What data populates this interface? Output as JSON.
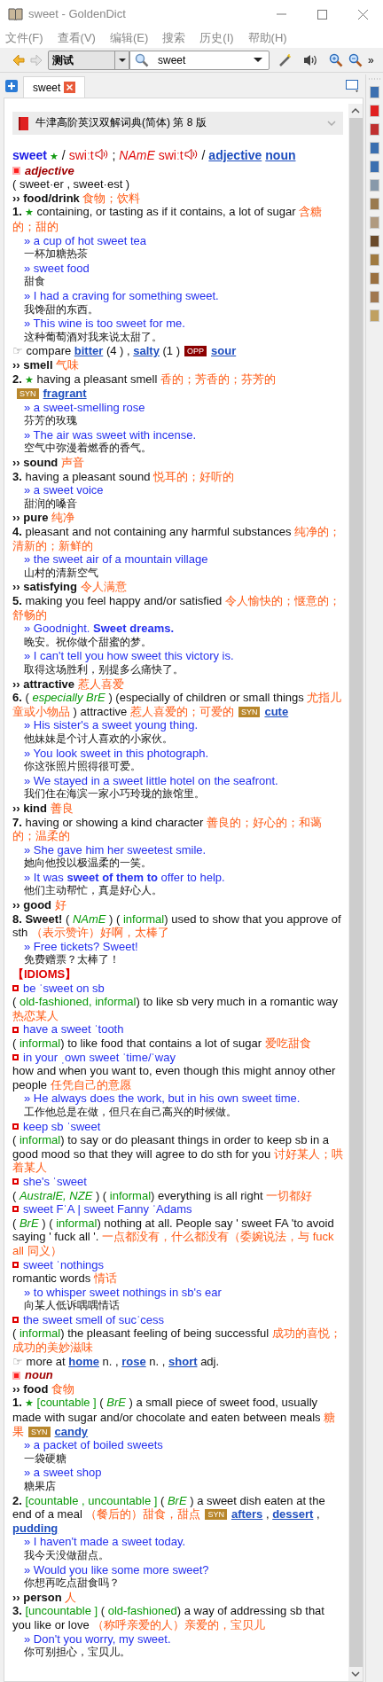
{
  "window": {
    "title": "sweet - GoldenDict"
  },
  "menu": [
    "文件(F)",
    "查看(V)",
    "编辑(E)",
    "搜索",
    "历史(I)",
    "帮助(H)"
  ],
  "toolbar": {
    "group": "测试",
    "search": "sweet",
    "more": "»"
  },
  "tabs": [
    {
      "label": "sweet",
      "selected": true
    }
  ],
  "dictionary": {
    "title": "牛津高阶英汉双解词典(简体) 第 8 版"
  },
  "entry": [
    {
      "kind": "headword",
      "parts": [
        {
          "kind": "headword",
          "text": "sweet"
        },
        {
          "kind": "star",
          "text": " ★"
        },
        {
          "kind": "plain",
          "text": " / "
        },
        {
          "kind": "pron",
          "text": "swiːt"
        },
        {
          "kind": "speaker"
        },
        {
          "kind": "plain",
          "text": " ; "
        },
        {
          "kind": "pron_i",
          "text": "NAmE"
        },
        {
          "kind": "pron",
          "text": " swiːt"
        },
        {
          "kind": "speaker"
        },
        {
          "kind": "plain",
          "text": " / "
        },
        {
          "kind": "link",
          "text": "adjective"
        },
        {
          "kind": "link",
          "text": "noun"
        }
      ]
    },
    {
      "kind": "pos",
      "parts": [
        {
          "kind": "pos",
          "text": "adjective"
        }
      ]
    },
    {
      "kind": "line",
      "parts": [
        {
          "kind": "plain",
          "text": "( sweet·er , sweet·est )"
        }
      ]
    },
    {
      "kind": "section",
      "parts": [
        {
          "kind": "bold",
          "text": "›› food/drink"
        },
        {
          "kind": "zh",
          "text": " 食物；饮料"
        }
      ]
    },
    {
      "kind": "line",
      "parts": [
        {
          "kind": "bold",
          "text": "1."
        },
        {
          "kind": "star",
          "text": " ★"
        },
        {
          "kind": "plain",
          "text": "  containing, or tasting as if it contains, a lot of sugar "
        },
        {
          "kind": "zh",
          "text": "含糖的；甜的"
        }
      ]
    },
    {
      "kind": "example",
      "parts": [
        {
          "kind": "example",
          "text": "» a cup of hot sweet tea"
        }
      ]
    },
    {
      "kind": "translation",
      "parts": [
        {
          "kind": "plain",
          "text": "一杯加糖热茶"
        }
      ]
    },
    {
      "kind": "example",
      "parts": [
        {
          "kind": "example",
          "text": "» sweet food"
        }
      ]
    },
    {
      "kind": "translation",
      "parts": [
        {
          "kind": "plain",
          "text": "甜食"
        }
      ]
    },
    {
      "kind": "example",
      "parts": [
        {
          "kind": "example",
          "text": "» I had a craving for something sweet."
        }
      ]
    },
    {
      "kind": "translation",
      "parts": [
        {
          "kind": "plain",
          "text": "我馋甜的东西。"
        }
      ]
    },
    {
      "kind": "example",
      "parts": [
        {
          "kind": "example",
          "text": "» This wine is too sweet for me."
        }
      ]
    },
    {
      "kind": "translation",
      "parts": [
        {
          "kind": "plain",
          "text": "这种葡萄酒对我来说太甜了。"
        }
      ]
    },
    {
      "kind": "line",
      "parts": [
        {
          "kind": "hand",
          "text": "☞"
        },
        {
          "kind": "plain",
          "text": " compare "
        },
        {
          "kind": "link",
          "text": "bitter"
        },
        {
          "kind": "plain",
          "text": "  (4 ) , "
        },
        {
          "kind": "link",
          "text": "salty"
        },
        {
          "kind": "plain",
          "text": "  (1 )"
        },
        {
          "kind": "opp",
          "text": "OPP"
        },
        {
          "kind": "link",
          "text": "sour"
        }
      ]
    },
    {
      "kind": "section",
      "parts": [
        {
          "kind": "bold",
          "text": "›› smell"
        },
        {
          "kind": "zh",
          "text": " 气味"
        }
      ]
    },
    {
      "kind": "line",
      "parts": [
        {
          "kind": "bold",
          "text": "2."
        },
        {
          "kind": "star",
          "text": " ★"
        },
        {
          "kind": "plain",
          "text": "  having a pleasant smell "
        },
        {
          "kind": "zh",
          "text": "香的；芳香的；芬芳的"
        },
        {
          "kind": "syn",
          "text": "SYN"
        },
        {
          "kind": "link",
          "text": "fragrant"
        }
      ]
    },
    {
      "kind": "example",
      "parts": [
        {
          "kind": "example",
          "text": "» a sweet-smelling rose"
        }
      ]
    },
    {
      "kind": "translation",
      "parts": [
        {
          "kind": "plain",
          "text": "芬芳的玫瑰"
        }
      ]
    },
    {
      "kind": "example",
      "parts": [
        {
          "kind": "example",
          "text": "» The air was sweet with incense."
        }
      ]
    },
    {
      "kind": "translation",
      "parts": [
        {
          "kind": "plain",
          "text": "空气中弥漫着燃香的香气。"
        }
      ]
    },
    {
      "kind": "section",
      "parts": [
        {
          "kind": "bold",
          "text": "›› sound"
        },
        {
          "kind": "zh",
          "text": " 声音"
        }
      ]
    },
    {
      "kind": "line",
      "parts": [
        {
          "kind": "bold",
          "text": "3."
        },
        {
          "kind": "plain",
          "text": "  having a pleasant sound "
        },
        {
          "kind": "zh",
          "text": "悦耳的；好听的"
        }
      ]
    },
    {
      "kind": "example",
      "parts": [
        {
          "kind": "example",
          "text": "» a sweet voice"
        }
      ]
    },
    {
      "kind": "translation",
      "parts": [
        {
          "kind": "plain",
          "text": "甜润的嗓音"
        }
      ]
    },
    {
      "kind": "section",
      "parts": [
        {
          "kind": "bold",
          "text": "›› pure"
        },
        {
          "kind": "zh",
          "text": " 纯净"
        }
      ]
    },
    {
      "kind": "line",
      "parts": [
        {
          "kind": "bold",
          "text": "4."
        },
        {
          "kind": "plain",
          "text": "  pleasant and not containing any harmful substances "
        },
        {
          "kind": "zh",
          "text": "纯净的；清新的；新鲜的"
        }
      ]
    },
    {
      "kind": "example",
      "parts": [
        {
          "kind": "example",
          "text": "» the sweet air of a mountain village"
        }
      ]
    },
    {
      "kind": "translation",
      "parts": [
        {
          "kind": "plain",
          "text": "山村的清新空气"
        }
      ]
    },
    {
      "kind": "section",
      "parts": [
        {
          "kind": "bold",
          "text": "›› satisfying"
        },
        {
          "kind": "zh",
          "text": " 令人满意"
        }
      ]
    },
    {
      "kind": "line",
      "parts": [
        {
          "kind": "bold",
          "text": "5."
        },
        {
          "kind": "plain",
          "text": "  making you feel happy and/or satisfied "
        },
        {
          "kind": "zh",
          "text": "令人愉快的；惬意的；舒畅的"
        }
      ]
    },
    {
      "kind": "example",
      "parts": [
        {
          "kind": "example",
          "text": "» Goodnight. "
        },
        {
          "kind": "example_bold",
          "text": "Sweet dreams."
        }
      ]
    },
    {
      "kind": "translation",
      "parts": [
        {
          "kind": "plain",
          "text": "晚安。祝你做个甜蜜的梦。"
        }
      ]
    },
    {
      "kind": "example",
      "parts": [
        {
          "kind": "example",
          "text": "» I can't tell you how sweet this victory is."
        }
      ]
    },
    {
      "kind": "translation",
      "parts": [
        {
          "kind": "plain",
          "text": "取得这场胜利，别提多么痛快了。"
        }
      ]
    },
    {
      "kind": "section",
      "parts": [
        {
          "kind": "bold",
          "text": "›› attractive"
        },
        {
          "kind": "zh",
          "text": " 惹人喜爱"
        }
      ]
    },
    {
      "kind": "line",
      "parts": [
        {
          "kind": "bold",
          "text": "6."
        },
        {
          "kind": "plain",
          "text": " ( "
        },
        {
          "kind": "label_i",
          "text": "especially BrE"
        },
        {
          "kind": "plain",
          "text": " ) (especially of children or small things "
        },
        {
          "kind": "zh",
          "text": "尤指儿童或小物品"
        },
        {
          "kind": "plain",
          "text": " ) attractive "
        },
        {
          "kind": "zh",
          "text": "惹人喜爱的；可爱的"
        },
        {
          "kind": "syn",
          "text": "SYN"
        },
        {
          "kind": "link",
          "text": "cute"
        }
      ]
    },
    {
      "kind": "example",
      "parts": [
        {
          "kind": "example",
          "text": "» His sister's a sweet young thing."
        }
      ]
    },
    {
      "kind": "translation",
      "parts": [
        {
          "kind": "plain",
          "text": "他妹妹是个讨人喜欢的小家伙。"
        }
      ]
    },
    {
      "kind": "example",
      "parts": [
        {
          "kind": "example",
          "text": "» You look sweet in this photograph."
        }
      ]
    },
    {
      "kind": "translation",
      "parts": [
        {
          "kind": "plain",
          "text": "你这张照片照得很可爱。"
        }
      ]
    },
    {
      "kind": "example",
      "parts": [
        {
          "kind": "example",
          "text": "» We stayed in a sweet little hotel on the seafront."
        }
      ]
    },
    {
      "kind": "translation",
      "parts": [
        {
          "kind": "plain",
          "text": "我们住在海滨一家小巧玲珑的旅馆里。"
        }
      ]
    },
    {
      "kind": "section",
      "parts": [
        {
          "kind": "bold",
          "text": "›› kind"
        },
        {
          "kind": "zh",
          "text": " 善良"
        }
      ]
    },
    {
      "kind": "line",
      "parts": [
        {
          "kind": "bold",
          "text": "7."
        },
        {
          "kind": "plain",
          "text": "  having or showing a kind character "
        },
        {
          "kind": "zh",
          "text": "善良的；好心的；和蔼的；温柔的"
        }
      ]
    },
    {
      "kind": "example",
      "parts": [
        {
          "kind": "example",
          "text": "» She gave him her sweetest smile."
        }
      ]
    },
    {
      "kind": "translation",
      "parts": [
        {
          "kind": "plain",
          "text": "她向他投以极温柔的一笑。"
        }
      ]
    },
    {
      "kind": "example",
      "parts": [
        {
          "kind": "example",
          "text": "» It was "
        },
        {
          "kind": "example_bold",
          "text": "sweet of them to"
        },
        {
          "kind": "example",
          "text": " offer to help."
        }
      ]
    },
    {
      "kind": "translation",
      "parts": [
        {
          "kind": "plain",
          "text": "他们主动帮忙，真是好心人。"
        }
      ]
    },
    {
      "kind": "section",
      "parts": [
        {
          "kind": "bold",
          "text": "›› good"
        },
        {
          "kind": "zh",
          "text": " 好"
        }
      ]
    },
    {
      "kind": "line",
      "parts": [
        {
          "kind": "bold",
          "text": "8. Sweet!"
        },
        {
          "kind": "plain",
          "text": " ( "
        },
        {
          "kind": "label_i",
          "text": "NAmE"
        },
        {
          "kind": "plain",
          "text": " ) ( "
        },
        {
          "kind": "label",
          "text": "informal"
        },
        {
          "kind": "plain",
          "text": ") used to show that you approve of sth "
        },
        {
          "kind": "zh",
          "text": "（表示赞许）好啊，太棒了"
        }
      ]
    },
    {
      "kind": "example",
      "parts": [
        {
          "kind": "example",
          "text": "» Free tickets? Sweet!"
        }
      ]
    },
    {
      "kind": "translation",
      "parts": [
        {
          "kind": "plain",
          "text": "免费赠票？太棒了！"
        }
      ]
    },
    {
      "kind": "idioms_heading",
      "parts": [
        {
          "kind": "heading",
          "text": "【IDIOMS】"
        }
      ]
    },
    {
      "kind": "idiom",
      "parts": [
        {
          "kind": "example",
          "text": "be ˈsweet on sb"
        }
      ]
    },
    {
      "kind": "line",
      "parts": [
        {
          "kind": "plain",
          "text": "( "
        },
        {
          "kind": "label",
          "text": "old-fashioned, informal"
        },
        {
          "kind": "plain",
          "text": ") to like sb very much in a romantic way "
        },
        {
          "kind": "zh",
          "text": "热恋某人"
        }
      ]
    },
    {
      "kind": "idiom",
      "parts": [
        {
          "kind": "example",
          "text": "have a sweet ˈtooth"
        }
      ]
    },
    {
      "kind": "line",
      "parts": [
        {
          "kind": "plain",
          "text": "( "
        },
        {
          "kind": "label",
          "text": "informal"
        },
        {
          "kind": "plain",
          "text": ") to like food that contains a lot of sugar "
        },
        {
          "kind": "zh",
          "text": "爱吃甜食"
        }
      ]
    },
    {
      "kind": "idiom",
      "parts": [
        {
          "kind": "example",
          "text": "in your ˌown sweet ˈtime/ˈway"
        }
      ]
    },
    {
      "kind": "line",
      "parts": [
        {
          "kind": "plain",
          "text": " how and when you want to, even though this might annoy other people "
        },
        {
          "kind": "zh",
          "text": "任凭自己的意愿"
        }
      ]
    },
    {
      "kind": "example",
      "parts": [
        {
          "kind": "example",
          "text": "» He always does the work, but in his own sweet time."
        }
      ]
    },
    {
      "kind": "translation",
      "parts": [
        {
          "kind": "plain",
          "text": "工作他总是在做，但只在自己高兴的时候做。"
        }
      ]
    },
    {
      "kind": "idiom",
      "parts": [
        {
          "kind": "example",
          "text": "keep sb ˈsweet"
        }
      ]
    },
    {
      "kind": "line",
      "parts": [
        {
          "kind": "plain",
          "text": "( "
        },
        {
          "kind": "label",
          "text": "informal"
        },
        {
          "kind": "plain",
          "text": ") to say or do pleasant things in order to keep sb in a good mood so that they will agree to do sth for you "
        },
        {
          "kind": "zh",
          "text": "讨好某人；哄着某人"
        }
      ]
    },
    {
      "kind": "idiom",
      "parts": [
        {
          "kind": "example",
          "text": "she's ˈsweet"
        }
      ]
    },
    {
      "kind": "line",
      "parts": [
        {
          "kind": "plain",
          "text": "( "
        },
        {
          "kind": "label_i",
          "text": "AustralE,  NZE"
        },
        {
          "kind": "plain",
          "text": " ) ( "
        },
        {
          "kind": "label",
          "text": "informal"
        },
        {
          "kind": "plain",
          "text": ") everything is all right "
        },
        {
          "kind": "zh",
          "text": "一切都好"
        }
      ]
    },
    {
      "kind": "idiom",
      "parts": [
        {
          "kind": "example",
          "text": "sweet FˈA | sweet Fanny ˈAdams"
        }
      ]
    },
    {
      "kind": "line",
      "parts": [
        {
          "kind": "plain",
          "text": "( "
        },
        {
          "kind": "label_i",
          "text": "BrE"
        },
        {
          "kind": "plain",
          "text": " ) ( "
        },
        {
          "kind": "label",
          "text": "informal"
        },
        {
          "kind": "plain",
          "text": ") nothing at all. People say ' sweet FA 'to avoid saying ' fuck all '. "
        },
        {
          "kind": "zh",
          "text": "一点都没有，什么都没有（委婉说法，与 fuck all 同义）"
        }
      ]
    },
    {
      "kind": "idiom",
      "parts": [
        {
          "kind": "example",
          "text": "sweet ˈnothings"
        }
      ]
    },
    {
      "kind": "line",
      "parts": [
        {
          "kind": "plain",
          "text": " romantic words "
        },
        {
          "kind": "zh",
          "text": "情话"
        }
      ]
    },
    {
      "kind": "example",
      "parts": [
        {
          "kind": "example",
          "text": "» to whisper sweet nothings in sb's ear"
        }
      ]
    },
    {
      "kind": "translation",
      "parts": [
        {
          "kind": "plain",
          "text": "向某人低诉喁喁情话"
        }
      ]
    },
    {
      "kind": "idiom",
      "parts": [
        {
          "kind": "example",
          "text": "the sweet smell of sucˈcess"
        }
      ]
    },
    {
      "kind": "line",
      "parts": [
        {
          "kind": "plain",
          "text": "( "
        },
        {
          "kind": "label",
          "text": "informal"
        },
        {
          "kind": "plain",
          "text": ") the pleasant feeling of being successful "
        },
        {
          "kind": "zh",
          "text": "成功的喜悦；成功的美妙滋味"
        }
      ]
    },
    {
      "kind": "line",
      "parts": [
        {
          "kind": "hand",
          "text": "☞"
        },
        {
          "kind": "plain",
          "text": " more at "
        },
        {
          "kind": "link",
          "text": "home"
        },
        {
          "kind": "plain",
          "text": "  n. , "
        },
        {
          "kind": "link",
          "text": "rose"
        },
        {
          "kind": "plain",
          "text": "  n. , "
        },
        {
          "kind": "link",
          "text": "short"
        },
        {
          "kind": "plain",
          "text": "  adj."
        }
      ]
    },
    {
      "kind": "pos",
      "parts": [
        {
          "kind": "pos",
          "text": "noun"
        }
      ]
    },
    {
      "kind": "section",
      "parts": [
        {
          "kind": "bold",
          "text": "›› food"
        },
        {
          "kind": "zh",
          "text": " 食物"
        }
      ]
    },
    {
      "kind": "line",
      "parts": [
        {
          "kind": "bold",
          "text": "1."
        },
        {
          "kind": "star",
          "text": " ★"
        },
        {
          "kind": "label",
          "text": " [countable ]"
        },
        {
          "kind": "plain",
          "text": "  ( "
        },
        {
          "kind": "label_i",
          "text": "BrE"
        },
        {
          "kind": "plain",
          "text": " ) a small piece of sweet food, usually made with sugar and/or chocolate and eaten between meals "
        },
        {
          "kind": "zh",
          "text": "糖果"
        },
        {
          "kind": "syn",
          "text": "SYN"
        },
        {
          "kind": "link",
          "text": "candy"
        }
      ]
    },
    {
      "kind": "example",
      "parts": [
        {
          "kind": "example",
          "text": "» a packet of boiled sweets"
        }
      ]
    },
    {
      "kind": "translation",
      "parts": [
        {
          "kind": "plain",
          "text": "一袋硬糖"
        }
      ]
    },
    {
      "kind": "example",
      "parts": [
        {
          "kind": "example",
          "text": "» a sweet shop"
        }
      ]
    },
    {
      "kind": "translation",
      "parts": [
        {
          "kind": "plain",
          "text": "糖果店"
        }
      ]
    },
    {
      "kind": "line",
      "parts": [
        {
          "kind": "bold",
          "text": "2."
        },
        {
          "kind": "label",
          "text": " [countable ,  uncountable ]"
        },
        {
          "kind": "plain",
          "text": "  ( "
        },
        {
          "kind": "label_i",
          "text": "BrE"
        },
        {
          "kind": "plain",
          "text": " ) a sweet dish eaten at the end of a meal "
        },
        {
          "kind": "zh",
          "text": "（餐后的）甜食，甜点"
        },
        {
          "kind": "syn",
          "text": "SYN"
        },
        {
          "kind": "link",
          "text": "afters"
        },
        {
          "kind": "plain",
          "text": " , "
        },
        {
          "kind": "link",
          "text": "dessert"
        },
        {
          "kind": "plain",
          "text": " , "
        },
        {
          "kind": "link",
          "text": "pudding"
        }
      ]
    },
    {
      "kind": "example",
      "parts": [
        {
          "kind": "example",
          "text": "» I haven't made a sweet today."
        }
      ]
    },
    {
      "kind": "translation",
      "parts": [
        {
          "kind": "plain",
          "text": "我今天没做甜点。"
        }
      ]
    },
    {
      "kind": "example",
      "parts": [
        {
          "kind": "example",
          "text": "» Would you like some more sweet?"
        }
      ]
    },
    {
      "kind": "translation",
      "parts": [
        {
          "kind": "plain",
          "text": "你想再吃点甜食吗？"
        }
      ]
    },
    {
      "kind": "section",
      "parts": [
        {
          "kind": "bold",
          "text": "›› person"
        },
        {
          "kind": "zh",
          "text": " 人"
        }
      ]
    },
    {
      "kind": "line",
      "parts": [
        {
          "kind": "bold",
          "text": "3."
        },
        {
          "kind": "label",
          "text": " [uncountable ]"
        },
        {
          "kind": "plain",
          "text": "  ( "
        },
        {
          "kind": "label",
          "text": "old-fashioned"
        },
        {
          "kind": "plain",
          "text": ") a way of addressing sb that you like or love "
        },
        {
          "kind": "zh",
          "text": "（称呼亲爱的人）亲爱的，宝贝儿"
        }
      ]
    },
    {
      "kind": "example",
      "parts": [
        {
          "kind": "example",
          "text": "» Don't you worry, my sweet."
        }
      ]
    },
    {
      "kind": "translation",
      "parts": [
        {
          "kind": "plain",
          "text": "你可别担心，宝贝儿。"
        }
      ]
    }
  ]
}
